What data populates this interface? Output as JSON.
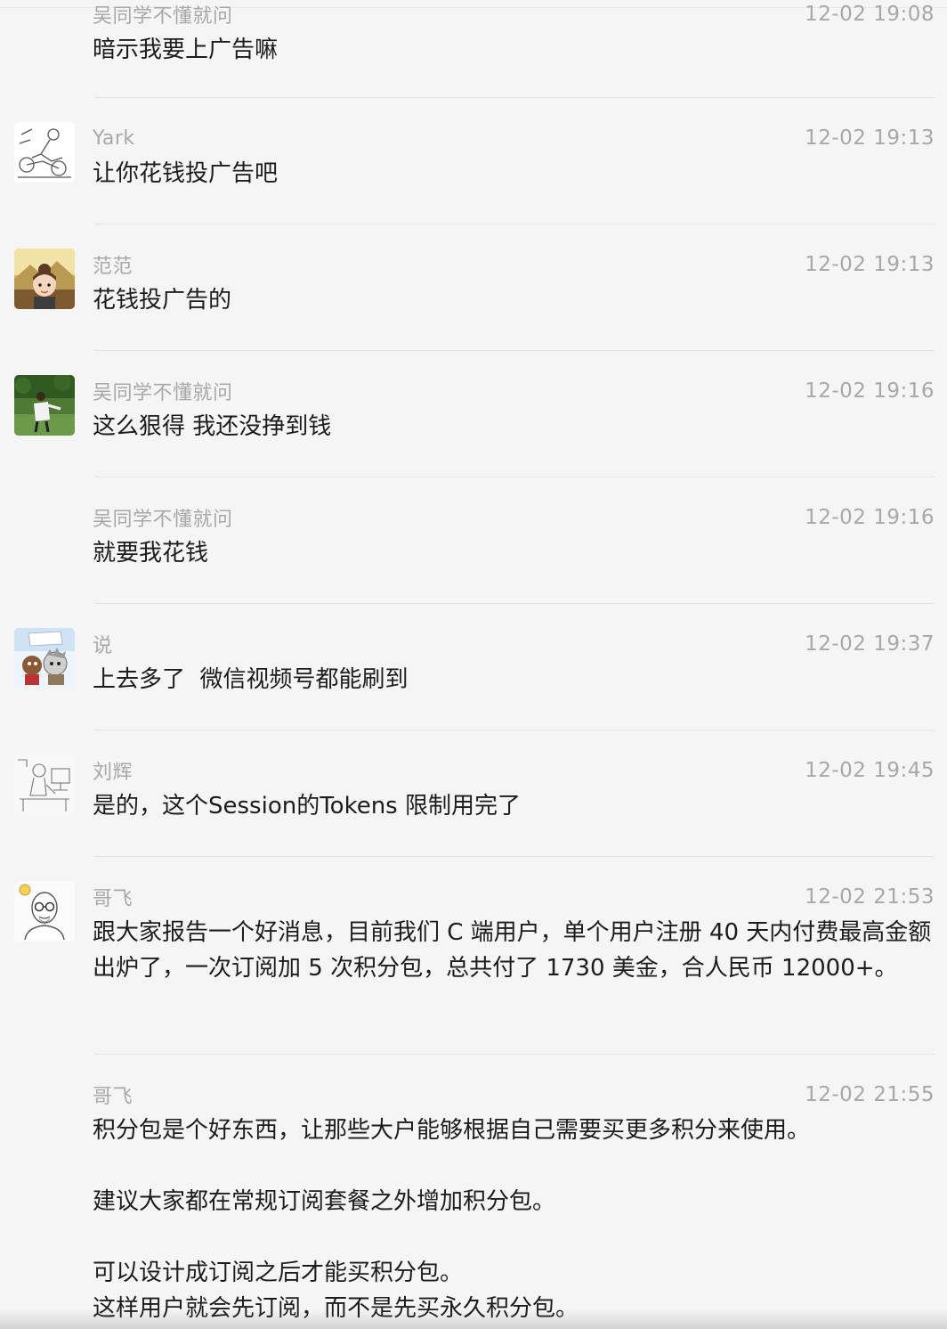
{
  "messages": [
    {
      "sender": "吴同学不懂就问",
      "time": "12-02 19:08",
      "text": "暗示我要上广告嘛",
      "avatar": "none"
    },
    {
      "sender": "Yark",
      "time": "12-02 19:13",
      "text": "让你花钱投广告吧",
      "avatar": "sketch-cyclist-avatar"
    },
    {
      "sender": "范范",
      "time": "12-02 19:13",
      "text": "花钱投广告的",
      "avatar": "cartoon-girl-avatar"
    },
    {
      "sender": "吴同学不懂就问",
      "time": "12-02 19:16",
      "text": "这么狠得 我还没挣到钱",
      "avatar": "photo-outdoor-person-avatar"
    },
    {
      "sender": "吴同学不懂就问",
      "time": "12-02 19:16",
      "text": "就要我花钱",
      "avatar": "none"
    },
    {
      "sender": "说",
      "time": "12-02 19:37",
      "text": "上去多了  微信视频号都能刷到",
      "avatar": "cartoon-animals-avatar"
    },
    {
      "sender": "刘辉",
      "time": "12-02 19:45",
      "text": "是的，这个Session的Tokens 限制用完了",
      "avatar": "sketch-desk-avatar"
    },
    {
      "sender": "哥飞",
      "time": "12-02 21:53",
      "text": "跟大家报告一个好消息，目前我们 C 端用户，单个用户注册 40 天内付费最高金额出炉了，一次订阅加 5 次积分包，总共付了 1730 美金，合人民币 12000+。",
      "avatar": "bald-glasses-man-avatar"
    },
    {
      "sender": "哥飞",
      "time": "12-02 21:55",
      "text": "积分包是个好东西，让那些大户能够根据自己需要买更多积分来使用。\n\n建议大家都在常规订阅套餐之外增加积分包。\n\n可以设计成订阅之后才能买积分包。\n这样用户就会先订阅，而不是先买永久积分包。",
      "avatar": "none"
    }
  ]
}
